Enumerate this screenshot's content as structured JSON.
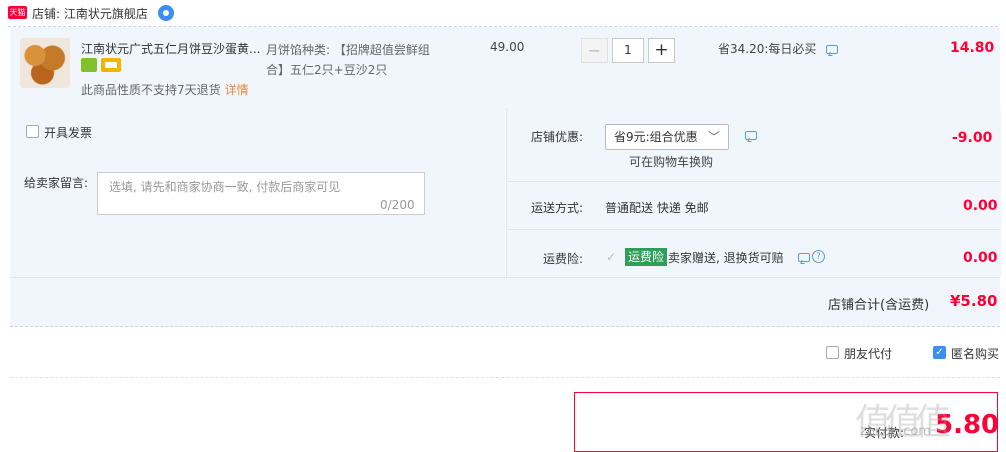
{
  "shop": {
    "badge": "天猫",
    "label": "店铺: 江南状元旗舰店"
  },
  "item": {
    "title": "江南状元广式五仁月饼豆沙蛋黄...",
    "notice": "此商品性质不支持7天退货",
    "notice_link": "详情",
    "sku_label": "月饼馅种类:",
    "sku_value": "【招牌超值尝鲜组合】五仁2只+豆沙2只",
    "unit_price": "49.00",
    "qty_minus": "−",
    "quantity": "1",
    "qty_plus": "+",
    "promo": "省34.20:每日必买",
    "line_total": "14.80"
  },
  "order_options": {
    "invoice_label": "开具发票",
    "message_label": "给卖家留言:",
    "message_placeholder": "选填, 请先和商家协商一致, 付款后商家可见",
    "message_count": "0/200",
    "shop_coupon_label": "店铺优惠:",
    "shop_coupon_value": "省9元:组合优惠",
    "shop_coupon_sub": "可在购物车换购",
    "shop_coupon_amount": "-9.00",
    "shipping_label": "运送方式:",
    "shipping_value": "普通配送 快递 免邮",
    "shipping_amount": "0.00",
    "insurance_label": "运费险:",
    "insurance_badge": "运费险",
    "insurance_text": "卖家赠送, 退换货可赔",
    "insurance_amount": "0.00"
  },
  "subtotal": {
    "label": "店铺合计(含运费)",
    "value": "¥5.80"
  },
  "checkout": {
    "friend_pay_label": "朋友代付",
    "anonymous_label": "匿名购买",
    "pay_label": "实付款:",
    "pay_amount": "5.80"
  },
  "watermark": {
    "glyphs": "值值值",
    "site": "zhi.de.com"
  },
  "colors": {
    "accent": "#ff0036",
    "panel": "#f1f6fd",
    "link": "#3c8ef3",
    "insurance": "#2e9e58"
  }
}
